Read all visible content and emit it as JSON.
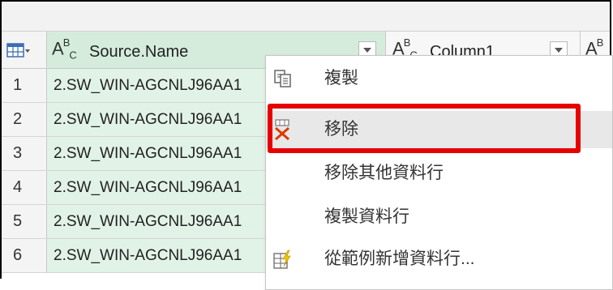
{
  "grid": {
    "header": {
      "source_name": "Source.Name",
      "column1": "Column1",
      "type_glyph_a": "A",
      "type_glyph_b": "B",
      "type_glyph_c": "C"
    },
    "rows": [
      {
        "num": "1",
        "source": "2.SW_WIN-AGCNLJ96AA1"
      },
      {
        "num": "2",
        "source": "2.SW_WIN-AGCNLJ96AA1"
      },
      {
        "num": "3",
        "source": "2.SW_WIN-AGCNLJ96AA1"
      },
      {
        "num": "4",
        "source": "2.SW_WIN-AGCNLJ96AA1"
      },
      {
        "num": "5",
        "source": "2.SW_WIN-AGCNLJ96AA1"
      },
      {
        "num": "6",
        "source": "2.SW_WIN-AGCNLJ96AA1"
      }
    ]
  },
  "context_menu": {
    "items": [
      {
        "label": "複製",
        "icon": "copy-icon"
      },
      {
        "label": "移除",
        "icon": "remove-icon",
        "highlighted": true
      },
      {
        "label": "移除其他資料行",
        "icon": ""
      },
      {
        "label": "複製資料行",
        "icon": ""
      },
      {
        "label": "從範例新增資料行...",
        "icon": "column-from-examples-icon"
      }
    ]
  },
  "colors": {
    "source_column_bg": "#e1f2e6",
    "highlight_border": "#e60000",
    "menu_hover": "#e8e8e8"
  }
}
